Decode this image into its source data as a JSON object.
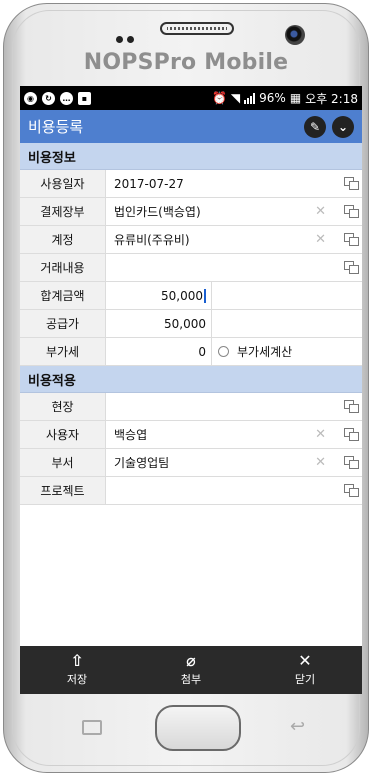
{
  "device": {
    "brand": "NOPSPro Mobile"
  },
  "status_bar": {
    "battery": "96%",
    "time": "오후 2:18"
  },
  "header": {
    "title": "비용등록",
    "icons": [
      "edit-icon",
      "chevron-down-icon"
    ]
  },
  "sections": {
    "cost_info": "비용정보",
    "cost_apply": "비용적용"
  },
  "fields": {
    "use_date": {
      "label": "사용일자",
      "value": "2017-07-27"
    },
    "payment": {
      "label": "결제장부",
      "value": "법인카드(백승엽)"
    },
    "account": {
      "label": "계정",
      "value": "유류비(주유비)"
    },
    "detail": {
      "label": "거래내용",
      "value": ""
    },
    "total": {
      "label": "합계금액",
      "value": "50,000"
    },
    "supply": {
      "label": "공급가",
      "value": "50,000"
    },
    "vat": {
      "label": "부가세",
      "value": "0",
      "option_label": "부가세계산"
    },
    "site": {
      "label": "현장",
      "value": ""
    },
    "user": {
      "label": "사용자",
      "value": "백승엽"
    },
    "dept": {
      "label": "부서",
      "value": "기술영업팀"
    },
    "project": {
      "label": "프로젝트",
      "value": ""
    }
  },
  "toolbar": {
    "save": "저장",
    "attach": "첨부",
    "close": "닫기"
  },
  "colors": {
    "header": "#4e7fcf",
    "section": "#c4d5ee",
    "toolbar": "#2a2a2a"
  }
}
